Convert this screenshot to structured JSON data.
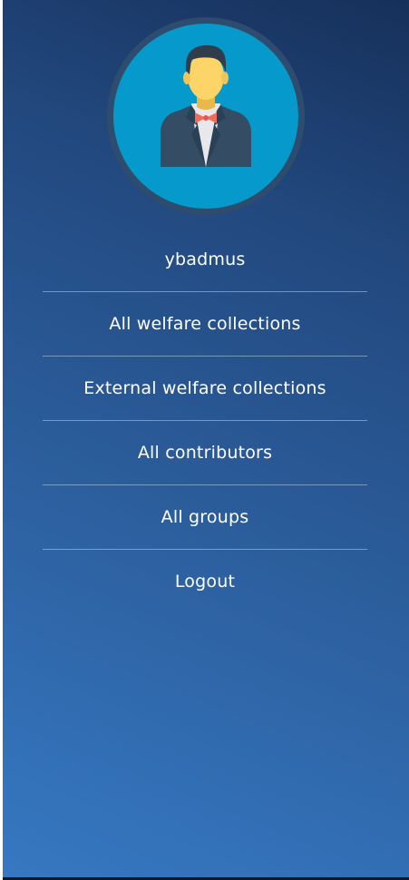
{
  "profile": {
    "username": "ybadmus",
    "avatar_icon": "businessman-avatar-icon"
  },
  "menu": {
    "items": [
      {
        "label": "All welfare collections"
      },
      {
        "label": "External welfare collections"
      },
      {
        "label": "All contributors"
      },
      {
        "label": "All groups"
      },
      {
        "label": "Logout"
      }
    ]
  },
  "colors": {
    "gradient_light": "#3678c2",
    "gradient_dark": "#16305a",
    "avatar_bg": "#059acb",
    "avatar_ring": "#2e4c6e",
    "text": "#ffffff"
  }
}
